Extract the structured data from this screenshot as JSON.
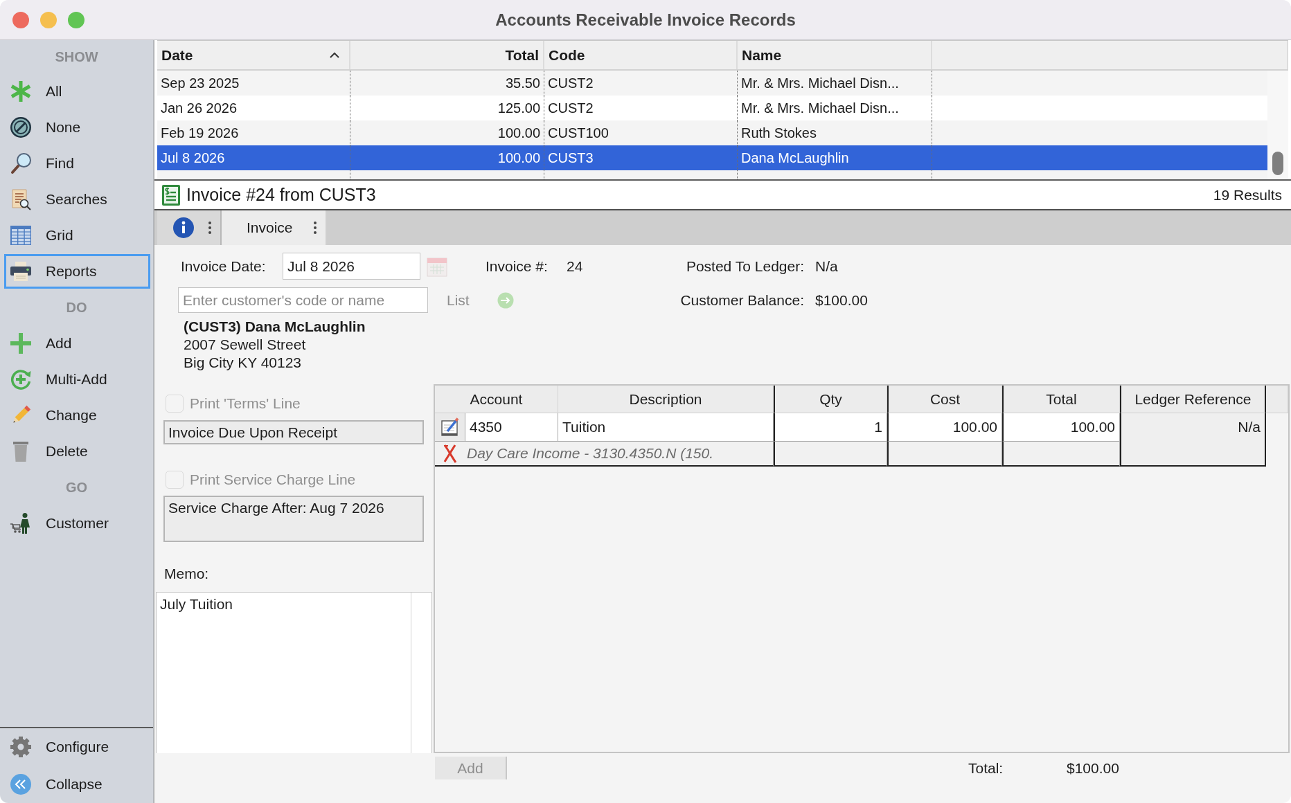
{
  "window": {
    "title": "Accounts Receivable Invoice Records"
  },
  "sidebar": {
    "sections": [
      {
        "heading": "SHOW",
        "items": [
          {
            "label": "All",
            "selected": false
          },
          {
            "label": "None",
            "selected": false
          },
          {
            "label": "Find",
            "selected": false
          },
          {
            "label": "Searches",
            "selected": false
          },
          {
            "label": "Grid",
            "selected": false
          },
          {
            "label": "Reports",
            "selected": true
          }
        ]
      },
      {
        "heading": "DO",
        "items": [
          {
            "label": "Add",
            "selected": false
          },
          {
            "label": "Multi-Add",
            "selected": false
          },
          {
            "label": "Change",
            "selected": false
          },
          {
            "label": "Delete",
            "selected": false
          }
        ]
      },
      {
        "heading": "GO",
        "items": [
          {
            "label": "Customer",
            "selected": false
          }
        ]
      }
    ],
    "footer_items": [
      {
        "label": "Configure"
      },
      {
        "label": "Collapse"
      }
    ]
  },
  "results_table": {
    "columns": [
      {
        "label": "Date",
        "sorted": true
      },
      {
        "label": "Total",
        "sorted": false
      },
      {
        "label": "Code",
        "sorted": false
      },
      {
        "label": "Name",
        "sorted": false
      }
    ],
    "rows": [
      {
        "cells": [
          "Sep 23 2025",
          "35.50",
          "CUST2",
          "Mr. & Mrs. Michael Disn..."
        ],
        "selected": false
      },
      {
        "cells": [
          "Jan 26 2026",
          "125.00",
          "CUST2",
          "Mr. & Mrs. Michael Disn..."
        ],
        "selected": false
      },
      {
        "cells": [
          "Feb 19 2026",
          "100.00",
          "CUST100",
          "Ruth Stokes"
        ],
        "selected": false
      },
      {
        "cells": [
          "Jul 8 2026",
          "100.00",
          "CUST3",
          "Dana McLaughlin"
        ],
        "selected": true
      }
    ]
  },
  "invoice_header": {
    "title": "Invoice #24 from CUST3",
    "results": "19 Results"
  },
  "tabs": [
    {
      "kind": "icon",
      "selected": false
    },
    {
      "kind": "text",
      "label": "Invoice",
      "selected": true
    }
  ],
  "invoice_form": {
    "invoice_date": {
      "label": "Invoice Date:",
      "value": "Jul 8 2026"
    },
    "invoice_number": {
      "label": "Invoice #:",
      "value": "24"
    },
    "posted_to_ledger": {
      "label": "Posted To Ledger:",
      "value": "N/a"
    },
    "customer_search": {
      "placeholder": "Enter customer's code or name"
    },
    "list_button": {
      "label": "List",
      "disabled": true
    },
    "customer_balance": {
      "label": "Customer Balance:",
      "value": "$100.00"
    },
    "customer_address": [
      "(CUST3) Dana McLaughlin",
      "2007 Sewell Street",
      "Big City KY 40123"
    ],
    "terms": {
      "label": "Print 'Terms' Line",
      "checked": false,
      "disabled": true,
      "value": "Invoice Due Upon Receipt"
    },
    "service_charge": {
      "label": "Print Service Charge Line",
      "checked": false,
      "disabled": true,
      "value": "Service Charge After: Aug 7 2026"
    },
    "memo": {
      "label": "Memo:",
      "value": "July Tuition"
    }
  },
  "line_items": {
    "columns": [
      "Account",
      "Description",
      "Qty",
      "Cost",
      "Total",
      "Ledger Reference"
    ],
    "rows": [
      {
        "account": "4350",
        "description": "Tuition",
        "qty": "1",
        "cost": "100.00",
        "total": "100.00",
        "ledger_reference": "N/a",
        "detail": "Day Care Income - 3130.4350.N (150."
      }
    ]
  },
  "footer": {
    "add_button": {
      "label": "Add",
      "disabled": true
    },
    "total": {
      "label": "Total:",
      "value": "$100.00"
    }
  }
}
